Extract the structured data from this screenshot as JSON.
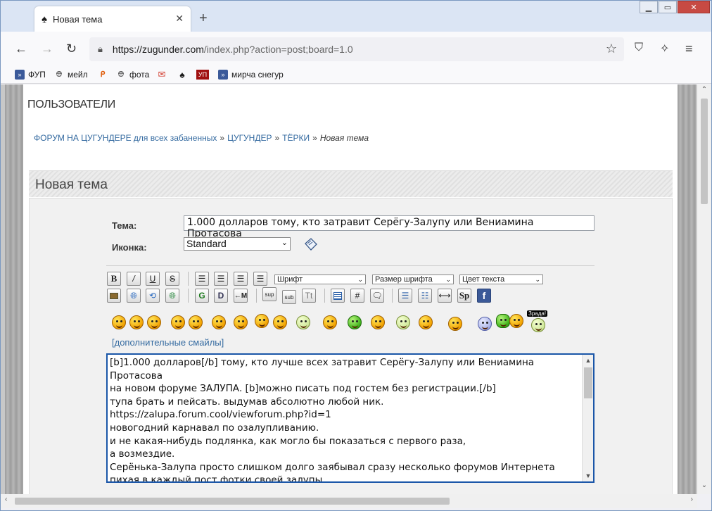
{
  "browser": {
    "tab_title": "Новая тема",
    "url_host": "https://zugunder.com",
    "url_rest": "/index.php?action=post;board=1.0",
    "bookmarks": [
      {
        "label": "ФУП",
        "icon": "forum-icon"
      },
      {
        "label": "мейл",
        "icon": "globe-icon"
      },
      {
        "label": "",
        "icon": "pin-icon"
      },
      {
        "label": "фота",
        "icon": "globe-icon"
      },
      {
        "label": "",
        "icon": "gmail-icon"
      },
      {
        "label": "",
        "icon": "spade-icon"
      },
      {
        "label": "УП",
        "icon": "up-icon"
      },
      {
        "label": "мирча снегур",
        "icon": "forum-icon"
      }
    ]
  },
  "page": {
    "site_title": "ПОЛЬЗОВАТЕЛИ",
    "breadcrumb": {
      "items": [
        "ФОРУМ НА ЦУГУНДЕРЕ для всех забаненных",
        "ЦУГУНДЕР",
        "ТЁРКИ"
      ],
      "separator": "»",
      "current": "Новая тема"
    },
    "section_title": "Новая тема",
    "form": {
      "subject_label": "Тема:",
      "subject_value": "1.000 долларов тому, кто затравит Серёгу-Залупу или Вениамина Протасова",
      "icon_label": "Иконка:",
      "icon_value": "Standard"
    },
    "toolbar": {
      "font_select": "Шрифт",
      "size_select": "Размер шрифта",
      "color_select": "Цвет текста",
      "sup": "sup",
      "sub": "sub",
      "tt": "Tt",
      "hash": "#",
      "sp": "Sp",
      "zrada": "Зрада!"
    },
    "more_smileys": "[дополнительные смайлы]",
    "message": "[b]1.000 долларов[/b] тому, кто лучше всех затравит Серёгу-Залупу или Вениамина Протасова\nна новом форуме ЗАЛУПА. [b]можно писать под гостем без регистрации.[/b]\nтупа брать и пейсать. выдумав абсолютно любой ник.\nhttps://zalupa.forum.cool/viewforum.php?id=1\nновогодний карнавал по озалупливанию.\nи не какая-нибудь подлянка, как могло бы показаться с первого раза,\nа возмездие.\nСерёнька-Залупа просто слишком долго заябывал сразу несколько форумов Интернета\nпихая в каждый пост фотки своей залупы."
  },
  "colors": {
    "link": "#346aa0",
    "editor_border": "#1a56a8",
    "window_close": "#c74a43"
  }
}
